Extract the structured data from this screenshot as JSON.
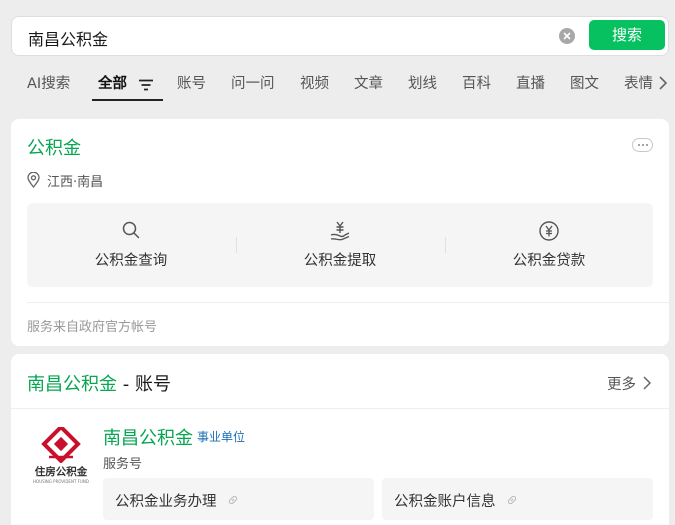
{
  "search": {
    "query": "南昌公积金",
    "button_label": "搜索"
  },
  "tabs": [
    {
      "label": "AI搜索"
    },
    {
      "label": "全部"
    },
    {
      "label": "账号"
    },
    {
      "label": "问一问"
    },
    {
      "label": "视频"
    },
    {
      "label": "文章"
    },
    {
      "label": "划线"
    },
    {
      "label": "百科"
    },
    {
      "label": "直播"
    },
    {
      "label": "图文"
    },
    {
      "label": "表情"
    }
  ],
  "service_card": {
    "title": "公积金",
    "location": "江西·南昌",
    "services": [
      {
        "label": "公积金查询",
        "icon": "search-icon"
      },
      {
        "label": "公积金提取",
        "icon": "yuan-hand-icon"
      },
      {
        "label": "公积金贷款",
        "icon": "yuan-circle-icon"
      }
    ],
    "footer": "服务来自政府官方帐号"
  },
  "account_card": {
    "title_highlight": "南昌公积金",
    "title_suffix": " - 账号",
    "more_label": "更多",
    "account": {
      "name": "南昌公积金",
      "tag": "事业单位",
      "type": "服务号",
      "logo_text": "住房公积金",
      "logo_subtext": "HOUSING PROVIDENT FUND"
    },
    "menus": [
      {
        "label": "公积金业务办理"
      },
      {
        "label": "公积金账户信息"
      }
    ]
  },
  "colors": {
    "brand_green": "#07c160",
    "title_green": "#07a652",
    "tag_blue": "#1e6fb8",
    "logo_red": "#c8102e"
  }
}
